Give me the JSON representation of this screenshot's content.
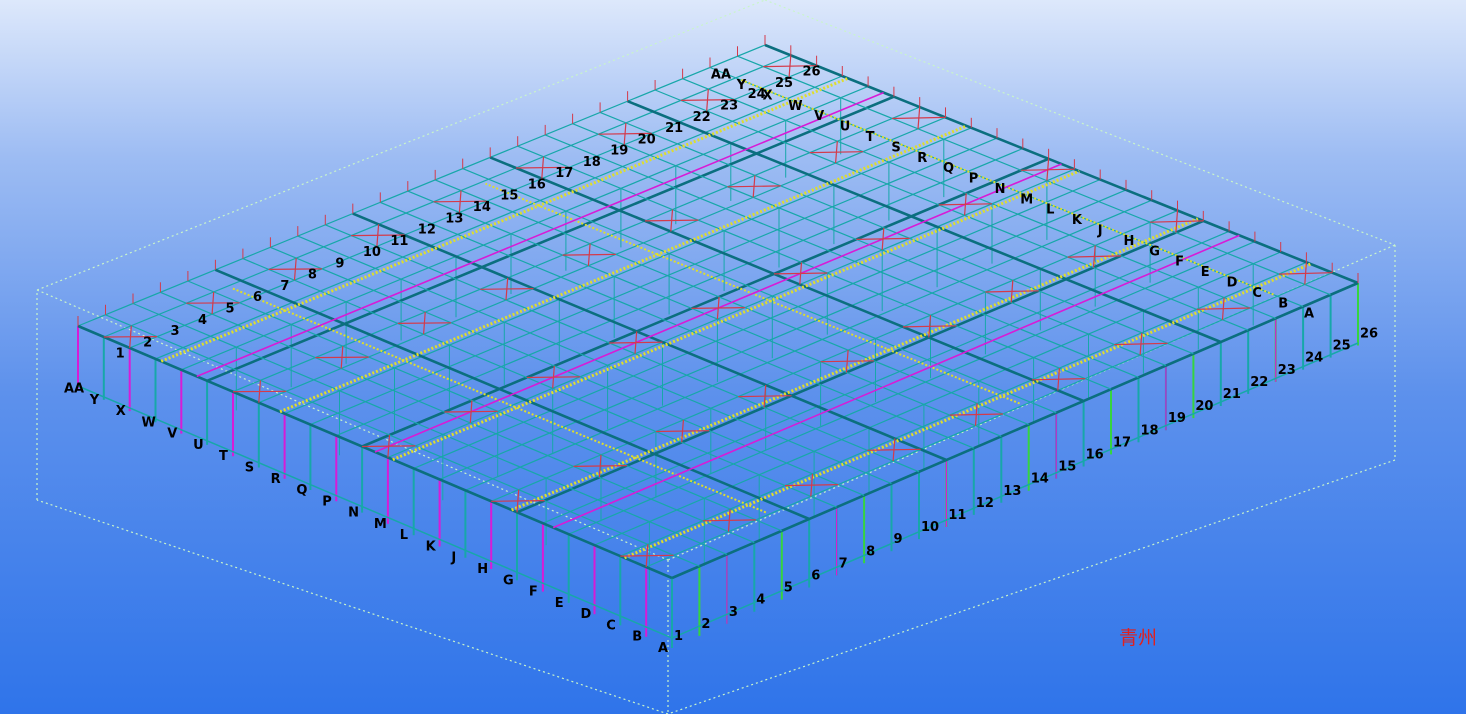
{
  "viewport": {
    "background_top": "#dde8fb",
    "background_bottom": "#2f74ea"
  },
  "model": {
    "colors": {
      "column": "#17a7a9",
      "rafter": "#0b6f7f",
      "purlin": "#dede2c",
      "brace": "#d81bd6",
      "secondary": "#d43a4a",
      "green_member": "#36d43f",
      "bounding_box": "#c9f5c9"
    },
    "numbered_grids": [
      "1",
      "2",
      "3",
      "4",
      "5",
      "6",
      "7",
      "8",
      "9",
      "10",
      "11",
      "12",
      "13",
      "14",
      "15",
      "16",
      "17",
      "18",
      "19",
      "20",
      "21",
      "22",
      "23",
      "24",
      "25",
      "26"
    ],
    "lettered_grids": [
      "A",
      "B",
      "C",
      "D",
      "E",
      "F",
      "G",
      "H",
      "J",
      "K",
      "L",
      "M",
      "N",
      "P",
      "Q",
      "R",
      "S",
      "T",
      "U",
      "V",
      "W",
      "X",
      "Y",
      "AA"
    ]
  },
  "watermark": {
    "text": "青州",
    "color": "#e0201e"
  }
}
